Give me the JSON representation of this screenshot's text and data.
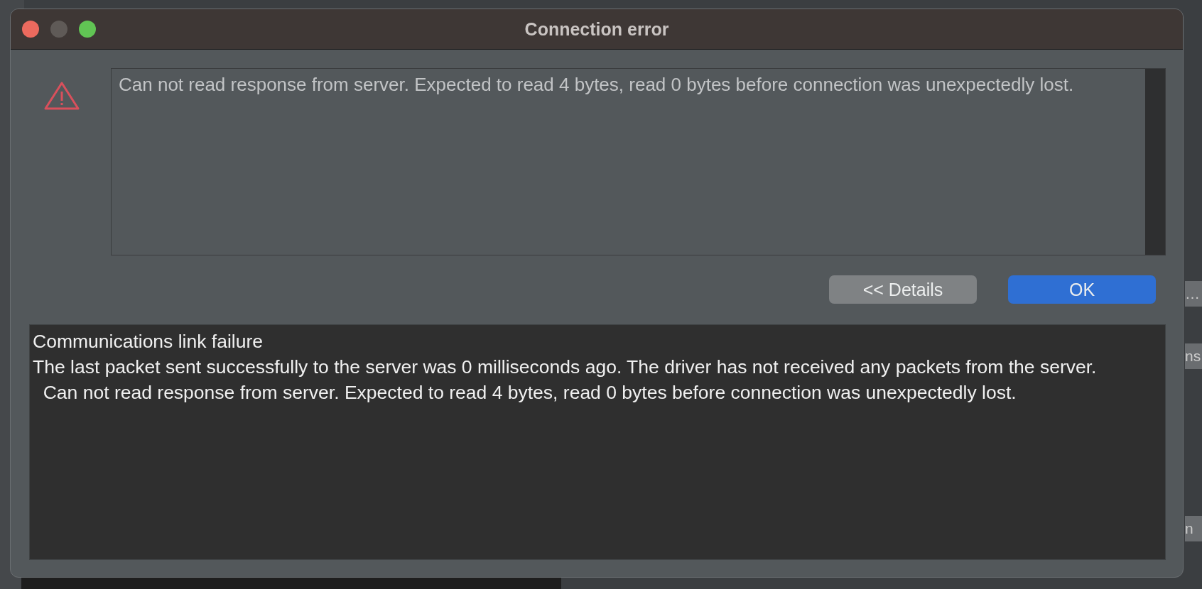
{
  "background": {
    "right_labels": [
      "…",
      "ns",
      "n"
    ]
  },
  "window": {
    "title": "Connection error",
    "controls": [
      {
        "kind": "close"
      },
      {
        "kind": "minimize"
      },
      {
        "kind": "zoom"
      }
    ]
  },
  "message": "Can not read response from server. Expected to read 4 bytes, read 0 bytes before connection was unexpectedly lost.",
  "buttons": [
    {
      "label": "<< Details",
      "kind": "secondary"
    },
    {
      "label": "OK",
      "kind": "primary"
    }
  ],
  "details": [
    "Communications link failure",
    "The last packet sent successfully to the server was 0 milliseconds ago. The driver has not received any packets from the server.",
    "  Can not read response from server. Expected to read 4 bytes, read 0 bytes before connection was unexpectedly lost."
  ]
}
